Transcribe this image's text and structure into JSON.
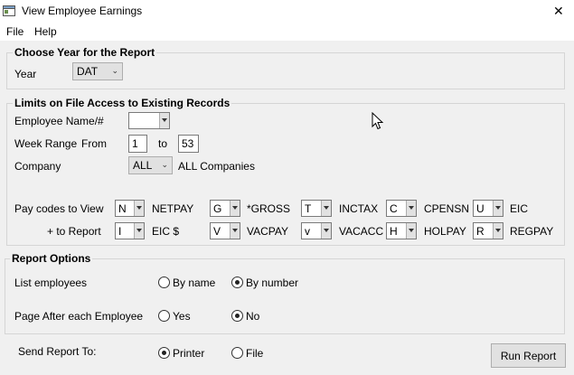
{
  "window": {
    "title": "View Employee Earnings",
    "close_glyph": "✕"
  },
  "menu": {
    "file": "File",
    "help": "Help"
  },
  "year_group": {
    "title": "Choose Year for the Report",
    "year_label": "Year",
    "year_value": "DAT"
  },
  "limits_group": {
    "title": "Limits on File Access to Existing Records",
    "employee_label": "Employee Name/#",
    "employee_value": "",
    "week_range_label": "Week Range",
    "from_label": "From",
    "from_value": "1",
    "to_label": "to",
    "to_value": "53",
    "company_label": "Company",
    "company_value": "ALL",
    "company_desc": "ALL Companies",
    "pay_codes_label": "Pay codes to View",
    "to_report_label": "+ to Report",
    "codes_row1": [
      {
        "code": "N",
        "name": "NETPAY"
      },
      {
        "code": "G",
        "name": "*GROSS"
      },
      {
        "code": "T",
        "name": "INCTAX"
      },
      {
        "code": "C",
        "name": "CPENSN"
      },
      {
        "code": "U",
        "name": "EIC"
      }
    ],
    "codes_row2": [
      {
        "code": "I",
        "name": "EIC $"
      },
      {
        "code": "V",
        "name": "VACPAY"
      },
      {
        "code": "v",
        "name": "VACACC"
      },
      {
        "code": "H",
        "name": "HOLPAY"
      },
      {
        "code": "R",
        "name": "REGPAY"
      }
    ]
  },
  "options_group": {
    "title": "Report Options",
    "list_label": "List employees",
    "by_name": "By name",
    "by_number": "By number",
    "list_selected": "By number",
    "page_label": "Page After each Employee",
    "yes": "Yes",
    "no": "No",
    "page_selected": "No"
  },
  "send": {
    "label": "Send Report To:",
    "printer": "Printer",
    "file": "File",
    "selected": "Printer"
  },
  "run_button": "Run Report",
  "colors": {
    "window_bg": "#f0f0f0",
    "border": "#d5d5d5",
    "control_bg": "#e1e1e1"
  },
  "icons": {
    "app": "app-icon",
    "cursor": "mouse-cursor-icon"
  }
}
